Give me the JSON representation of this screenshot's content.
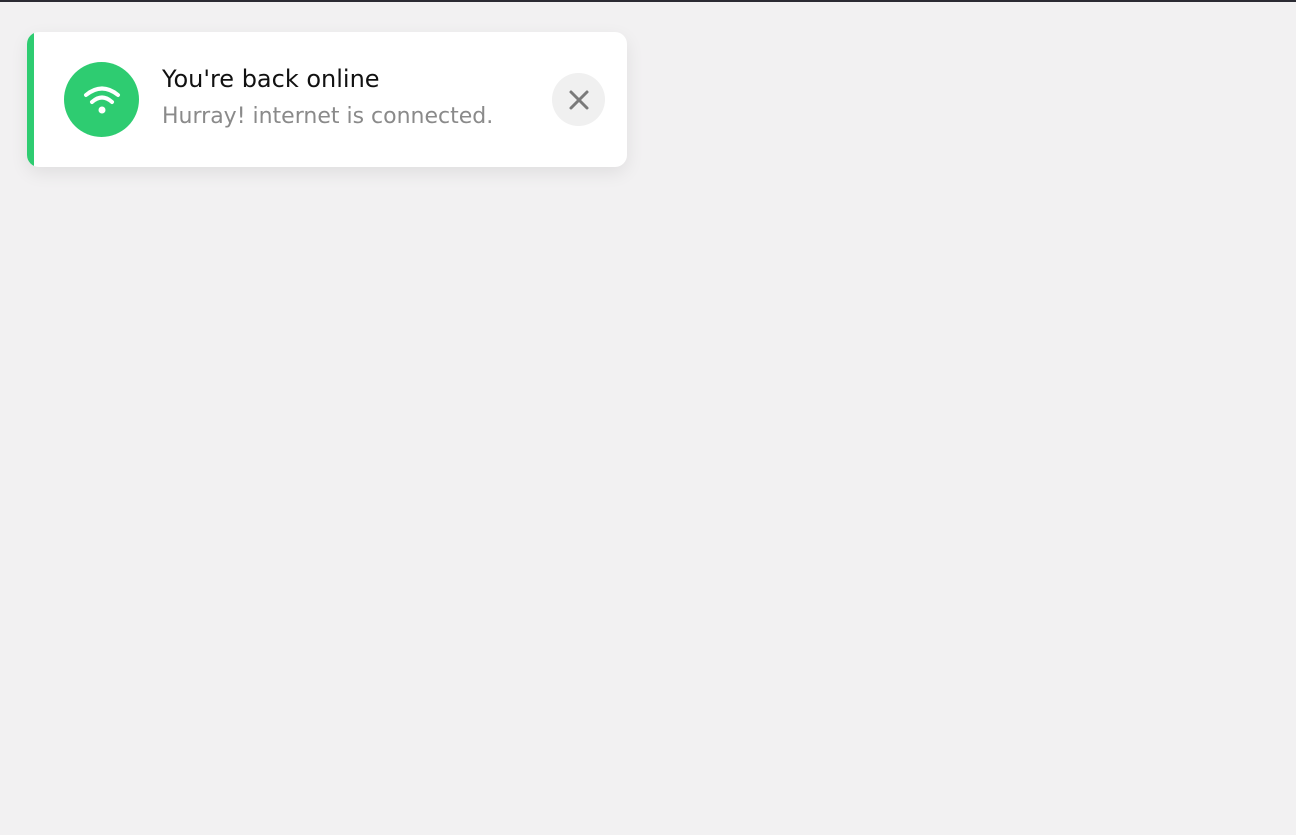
{
  "toast": {
    "title": "You're back online",
    "message": "Hurray! internet is connected.",
    "icon": "wifi-icon",
    "close_icon": "close-icon",
    "colors": {
      "accent": "#2ecc71",
      "background": "#ffffff",
      "page_background": "#f2f1f2",
      "title": "#111111",
      "message": "#8a8a8a",
      "close_bg": "#f0f0f0",
      "close_icon": "#7a7a7a"
    }
  }
}
